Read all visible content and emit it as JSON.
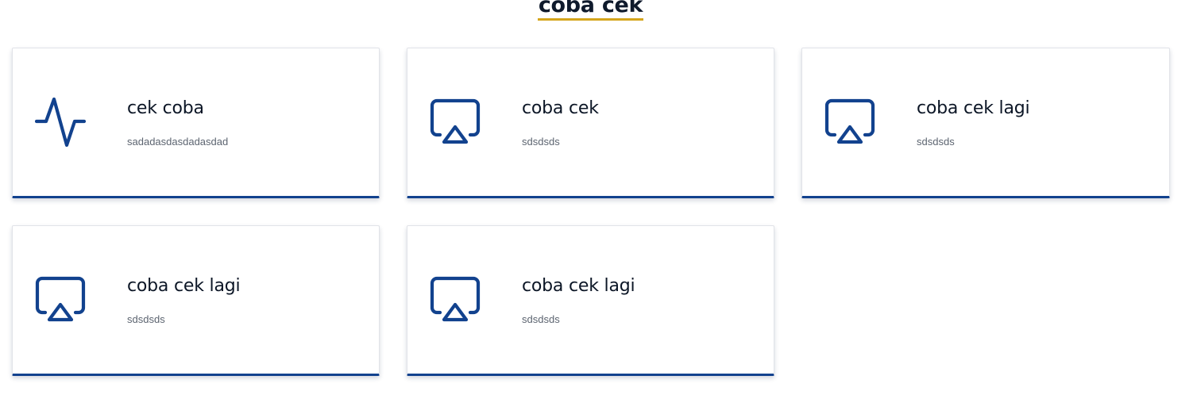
{
  "section": {
    "title": "coba cek"
  },
  "colors": {
    "accent_blue": "#12428e",
    "title_underline": "#d4a51c"
  },
  "cards": [
    {
      "icon": "activity-pulse-icon",
      "title": "cek coba",
      "description": "sadadasdasdadasdad"
    },
    {
      "icon": "airplay-icon",
      "title": "coba cek",
      "description": "sdsdsds"
    },
    {
      "icon": "airplay-icon",
      "title": "coba cek lagi",
      "description": "sdsdsds"
    },
    {
      "icon": "airplay-icon",
      "title": "coba cek lagi",
      "description": "sdsdsds"
    },
    {
      "icon": "airplay-icon",
      "title": "coba cek lagi",
      "description": "sdsdsds"
    }
  ]
}
